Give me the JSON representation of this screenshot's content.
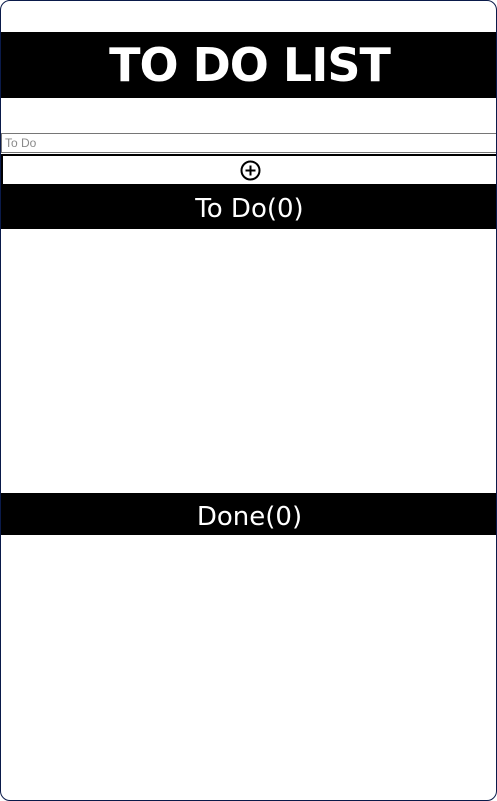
{
  "app": {
    "title": "TO DO LIST"
  },
  "input": {
    "placeholder": "To Do",
    "value": ""
  },
  "add_button": {
    "icon": "plus-circle-icon"
  },
  "todo_section": {
    "label": "To Do(0)",
    "items": []
  },
  "done_section": {
    "label": "Done(0)",
    "items": []
  },
  "colors": {
    "header_background": "#000000",
    "header_text": "#ffffff",
    "frame_border": "#0a1a4a"
  }
}
